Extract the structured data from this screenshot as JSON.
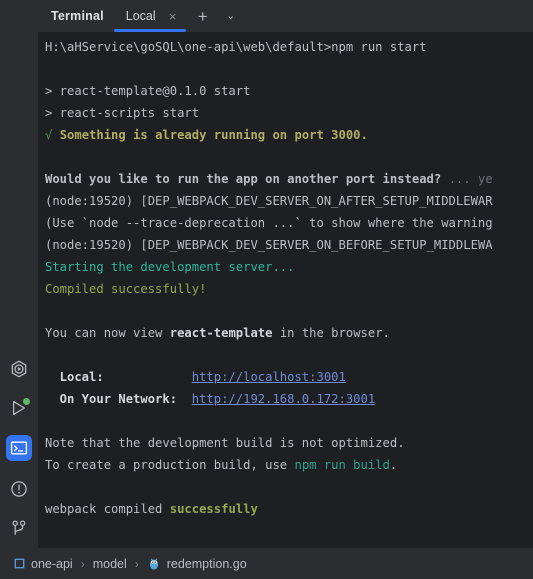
{
  "window": {
    "tool_title": "Terminal"
  },
  "tabs": {
    "items": [
      {
        "label": "Local",
        "close": "×",
        "active": true
      }
    ],
    "add_label": "+",
    "dropdown_label": "⌄"
  },
  "activity_bar": {
    "items": [
      {
        "name": "services-icon",
        "title": "Services"
      },
      {
        "name": "run-icon",
        "title": "Run",
        "badge": "green-dot"
      },
      {
        "name": "terminal-icon",
        "title": "Terminal",
        "active": true
      },
      {
        "name": "problems-icon",
        "title": "Problems"
      },
      {
        "name": "git-branch-icon",
        "title": "Version Control"
      }
    ]
  },
  "terminal": {
    "lines": [
      {
        "segments": [
          {
            "text": "H:\\aHService\\goSQL\\one-api\\web\\default>npm run start",
            "color": "#bcbec4"
          }
        ]
      },
      {
        "segments": []
      },
      {
        "segments": [
          {
            "text": "> react-template@0.1.0 start",
            "color": "#bcbec4"
          }
        ]
      },
      {
        "segments": [
          {
            "text": "> react-scripts start",
            "color": "#bcbec4"
          }
        ]
      },
      {
        "segments": [
          {
            "text": "√ ",
            "color": "#499c54"
          },
          {
            "text": "Something is already running on port 3000.",
            "color": "#b3ae60",
            "bold": true
          }
        ]
      },
      {
        "segments": []
      },
      {
        "segments": [
          {
            "text": "Would you like to run the app on another port instead? ",
            "color": "#bcbec4",
            "bold": true
          },
          {
            "text": "... ye",
            "color": "#6e7379"
          }
        ]
      },
      {
        "segments": [
          {
            "text": "(node:19520) [DEP_WEBPACK_DEV_SERVER_ON_AFTER_SETUP_MIDDLEWAR",
            "color": "#bcbec4"
          }
        ]
      },
      {
        "segments": [
          {
            "text": "(Use `node --trace-deprecation ...` to show where the warning",
            "color": "#bcbec4"
          }
        ]
      },
      {
        "segments": [
          {
            "text": "(node:19520) [DEP_WEBPACK_DEV_SERVER_ON_BEFORE_SETUP_MIDDLEWA",
            "color": "#bcbec4"
          }
        ]
      },
      {
        "segments": [
          {
            "text": "Starting the development server...",
            "color": "#29b8a0"
          }
        ]
      },
      {
        "segments": [
          {
            "text": "Compiled successfully!",
            "color": "#94a94a"
          }
        ]
      },
      {
        "segments": []
      },
      {
        "segments": [
          {
            "text": "You can now view ",
            "color": "#bcbec4"
          },
          {
            "text": "react-template",
            "color": "#d5d7dc",
            "bold": true
          },
          {
            "text": " in the browser.",
            "color": "#bcbec4"
          }
        ]
      },
      {
        "segments": []
      },
      {
        "segments": [
          {
            "text": "  Local:            ",
            "color": "#d5d7dc",
            "bold": true
          },
          {
            "text": "http://localhost:3001",
            "color": "#6e8cd8",
            "underline": true
          }
        ]
      },
      {
        "segments": [
          {
            "text": "  On Your Network:  ",
            "color": "#d5d7dc",
            "bold": true
          },
          {
            "text": "http://192.168.0.172:3001",
            "color": "#6e8cd8",
            "underline": true
          }
        ]
      },
      {
        "segments": []
      },
      {
        "segments": [
          {
            "text": "Note that the development build is not optimized.",
            "color": "#bcbec4"
          }
        ]
      },
      {
        "segments": [
          {
            "text": "To create a production build, use ",
            "color": "#bcbec4"
          },
          {
            "text": "npm run build",
            "color": "#29a38f"
          },
          {
            "text": ".",
            "color": "#bcbec4"
          }
        ]
      },
      {
        "segments": []
      },
      {
        "segments": [
          {
            "text": "webpack compiled ",
            "color": "#bcbec4"
          },
          {
            "text": "successfully",
            "color": "#94a94a",
            "bold": true
          }
        ]
      }
    ]
  },
  "breadcrumb": {
    "items": [
      {
        "label": "one-api",
        "icon": "project-square-icon"
      },
      {
        "label": "model",
        "icon": null
      },
      {
        "label": "redemption.go",
        "icon": "go-gopher-icon"
      }
    ],
    "separator": "›"
  },
  "colors": {
    "accent_blue": "#3574f0",
    "activity_bg": "#2b2d30",
    "terminal_bg": "#1e1f22",
    "link_blue": "#6e8cd8",
    "success_green": "#94a94a",
    "warning_yellow": "#b3ae60",
    "teal": "#29b8a0"
  }
}
